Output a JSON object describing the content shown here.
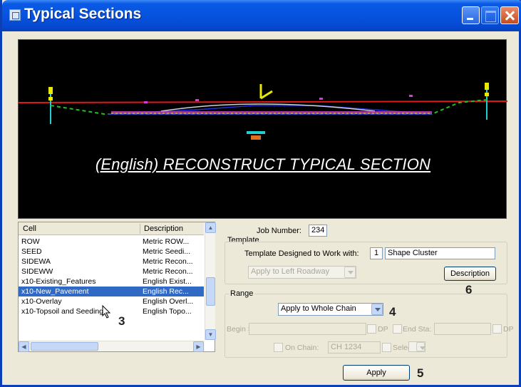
{
  "window": {
    "title": "Typical Sections"
  },
  "preview": {
    "caption": "(English) RECONSTRUCT TYPICAL SECTION"
  },
  "cell_list": {
    "columns": [
      "Cell",
      "Description"
    ],
    "rows": [
      {
        "cell": "ROW",
        "description": "Metric ROW..."
      },
      {
        "cell": "SEED",
        "description": "Metric Seedi..."
      },
      {
        "cell": "SIDEWA",
        "description": "Metric Recon..."
      },
      {
        "cell": "SIDEWW",
        "description": "Metric Recon..."
      },
      {
        "cell": "x10-Existing_Features",
        "description": "English Exist..."
      },
      {
        "cell": "x10-New_Pavement",
        "description": "English Rec...",
        "selected": true
      },
      {
        "cell": "x10-Overlay",
        "description": "English Overl..."
      },
      {
        "cell": "x10-Topsoil and Seeding",
        "description": "English Topo..."
      }
    ]
  },
  "job": {
    "label": "Job Number:",
    "value": "234"
  },
  "template": {
    "group_label": "Template",
    "designed_label": "Template Designed to Work with:",
    "designed_count": "1",
    "designed_value": "Shape Cluster",
    "apply_roadway": "Apply to Left Roadway",
    "description_button": "Description"
  },
  "range": {
    "group_label": "Range",
    "apply_option": "Apply to Whole Chain",
    "begin_sta_label": "Begin Sta:",
    "end_sta_label": "End Sta:",
    "dp_label": "DP",
    "on_chain_label": "On   Chain:",
    "chain_value": "CH 1234",
    "select_label": "Select"
  },
  "apply_button": "Apply",
  "callouts": {
    "c3": "3",
    "c4": "4",
    "c5": "5",
    "c6": "6"
  }
}
